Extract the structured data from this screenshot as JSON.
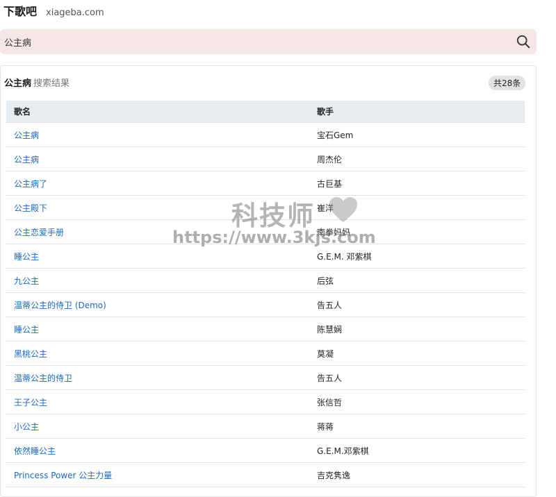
{
  "header": {
    "brand": "下歌吧",
    "domain": "xiageba.com"
  },
  "search": {
    "value": "公主病",
    "icon": "search-icon"
  },
  "results": {
    "query": "公主病",
    "suffix": "搜索结果",
    "count_badge": "共28条",
    "columns": [
      "歌名",
      "歌手"
    ],
    "rows": [
      {
        "song": "公主病",
        "singer": "宝石Gem"
      },
      {
        "song": "公主病",
        "singer": "周杰伦"
      },
      {
        "song": "公主病了",
        "singer": "古巨基"
      },
      {
        "song": "公主殿下",
        "singer": "崔洋"
      },
      {
        "song": "公主恋爱手册",
        "singer": "南拳妈妈"
      },
      {
        "song": "睡公主",
        "singer": "G.E.M. 邓紫棋"
      },
      {
        "song": "九公主",
        "singer": "后弦"
      },
      {
        "song": "温蒂公主的侍卫 (Demo)",
        "singer": "告五人"
      },
      {
        "song": "睡公主",
        "singer": "陈慧娴"
      },
      {
        "song": "黑桃公主",
        "singer": "莫凝"
      },
      {
        "song": "温蒂公主的侍卫",
        "singer": "告五人"
      },
      {
        "song": "王子公主",
        "singer": "张信哲"
      },
      {
        "song": "小公主",
        "singer": "蒋蒋"
      },
      {
        "song": "依然睡公主",
        "singer": "G.E.M.邓紫棋"
      },
      {
        "song": "Princess Power 公主力量",
        "singer": "吉克隽逸"
      }
    ]
  },
  "watermark": {
    "title": "科技师",
    "url": "https://www.3kjs.com",
    "icon": "heart-icon"
  }
}
